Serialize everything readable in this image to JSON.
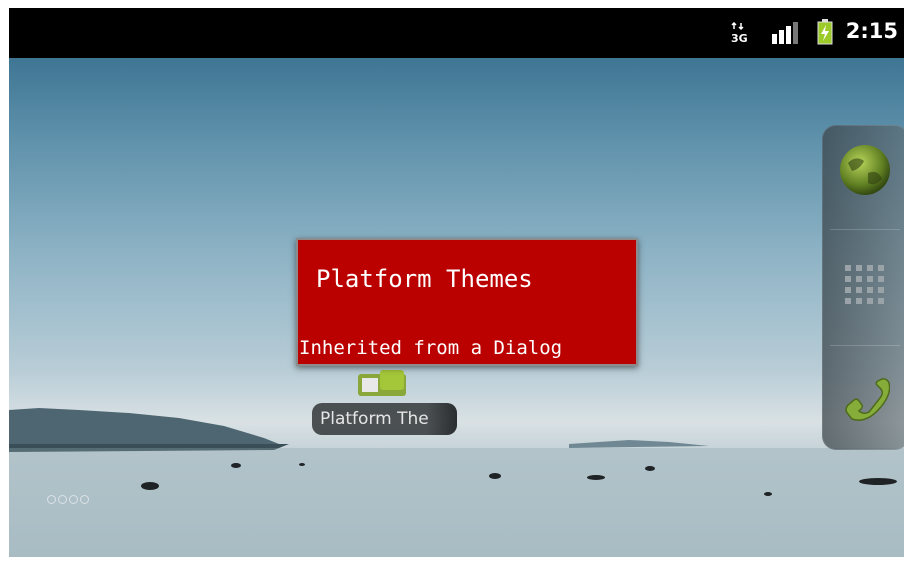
{
  "status_bar": {
    "time": "2:15",
    "network_icon": "3g-data-icon",
    "signal_icon": "signal-bars-icon",
    "battery_icon": "battery-charging-icon"
  },
  "toast": {
    "title": "Platform Themes",
    "subtitle": "Inherited from a Dialog"
  },
  "home_screen": {
    "app_shortcut_label": "Platform The",
    "page_indicator_count": 4
  },
  "dock": {
    "items": [
      {
        "icon": "browser-globe-icon"
      },
      {
        "icon": "app-drawer-grid-icon"
      },
      {
        "icon": "phone-handset-icon"
      }
    ]
  },
  "colors": {
    "toast_background": "#bb0000",
    "status_bar": "#000000",
    "text": "#ffffff"
  }
}
